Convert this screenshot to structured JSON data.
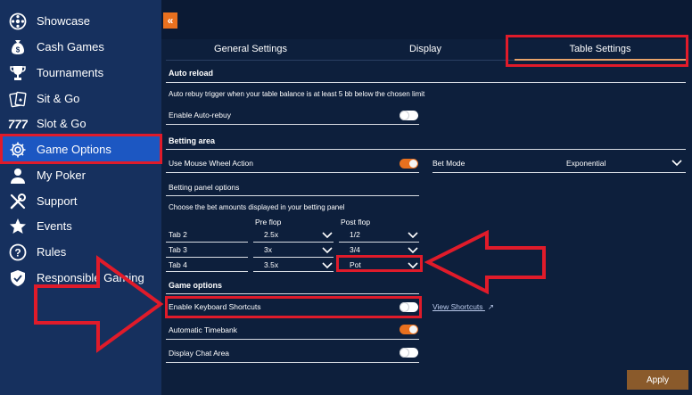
{
  "sidebar": {
    "items": [
      {
        "label": "Showcase",
        "icon": "showcase-icon"
      },
      {
        "label": "Cash Games",
        "icon": "money-bag-icon"
      },
      {
        "label": "Tournaments",
        "icon": "trophy-icon"
      },
      {
        "label": "Sit & Go",
        "icon": "cards-icon"
      },
      {
        "label": "Slot & Go",
        "icon": "slot-777-icon"
      },
      {
        "label": "Game Options",
        "icon": "gear-icon"
      },
      {
        "label": "My Poker",
        "icon": "user-icon"
      },
      {
        "label": "Support",
        "icon": "tools-icon"
      },
      {
        "label": "Events",
        "icon": "star-icon"
      },
      {
        "label": "Rules",
        "icon": "question-icon"
      },
      {
        "label": "Responsible Gaming",
        "icon": "shield-icon"
      }
    ],
    "active": "Game Options"
  },
  "tabs": [
    {
      "label": "General Settings"
    },
    {
      "label": "Display"
    },
    {
      "label": "Table Settings"
    }
  ],
  "active_tab": "Table Settings",
  "auto_reload": {
    "title": "Auto reload",
    "description": "Auto rebuy trigger when your table balance is at least 5 bb below the chosen limit",
    "enable_label": "Enable Auto-rebuy",
    "enable_on": false
  },
  "betting_area": {
    "title": "Betting area",
    "mouse_wheel_label": "Use Mouse Wheel Action",
    "mouse_wheel_on": true,
    "bet_mode_label": "Bet Mode",
    "bet_mode_value": "Exponential",
    "panel_options_label": "Betting panel options",
    "choose_label": "Choose the bet amounts displayed in your betting panel",
    "preflop_header": "Pre flop",
    "postflop_header": "Post flop",
    "rows": [
      {
        "tab": "Tab 2",
        "preflop": "2.5x",
        "postflop": "1/2"
      },
      {
        "tab": "Tab 3",
        "preflop": "3x",
        "postflop": "3/4"
      },
      {
        "tab": "Tab 4",
        "preflop": "3.5x",
        "postflop": "Pot"
      }
    ]
  },
  "game_options": {
    "title": "Game options",
    "keyboard_label": "Enable Keyboard Shortcuts",
    "keyboard_on": false,
    "view_shortcuts": "View Shortcuts",
    "timebank_label": "Automatic Timebank",
    "timebank_on": true,
    "chat_label": "Display Chat Area",
    "chat_on": false
  },
  "apply_label": "Apply",
  "colors": {
    "accent": "#e8701f",
    "highlight": "#e01b2a",
    "active_nav": "#1c57c2",
    "sidebar": "#16305e",
    "panel": "#0d1f3c"
  }
}
